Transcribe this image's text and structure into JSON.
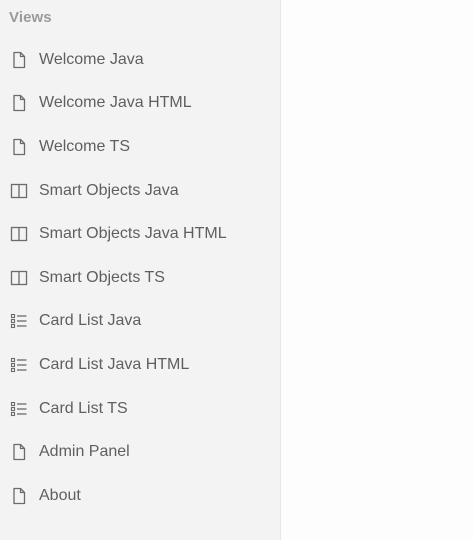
{
  "drawer": {
    "title": "Views",
    "items": [
      {
        "label": "Welcome Java",
        "icon": "file-icon"
      },
      {
        "label": "Welcome Java HTML",
        "icon": "file-icon"
      },
      {
        "label": "Welcome TS",
        "icon": "file-icon"
      },
      {
        "label": "Smart Objects Java",
        "icon": "split-panel-icon"
      },
      {
        "label": "Smart Objects Java HTML",
        "icon": "split-panel-icon"
      },
      {
        "label": "Smart Objects TS",
        "icon": "split-panel-icon"
      },
      {
        "label": "Card List Java",
        "icon": "list-icon"
      },
      {
        "label": "Card List Java HTML",
        "icon": "list-icon"
      },
      {
        "label": "Card List TS",
        "icon": "list-icon"
      },
      {
        "label": "Admin Panel",
        "icon": "file-icon"
      },
      {
        "label": "About",
        "icon": "file-icon"
      }
    ]
  },
  "colors": {
    "drawer_background": "#f3f3f3",
    "label_text": "#5f5f5f",
    "title_text": "#9a9a9a",
    "icon_stroke": "#6b6b6b"
  }
}
